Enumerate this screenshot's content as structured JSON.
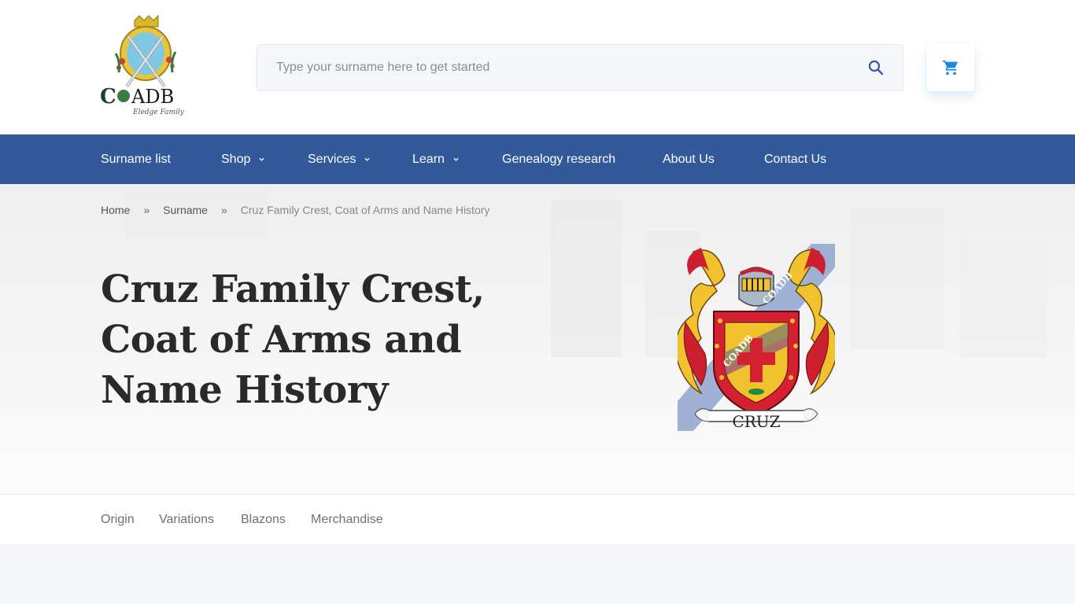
{
  "header": {
    "logo": {
      "text": "COADB",
      "subtitle": "Eledge Family"
    },
    "search": {
      "placeholder": "Type your surname here to get started",
      "value": ""
    },
    "icons": {
      "search": "search-icon",
      "cart": "shopping-cart-icon"
    }
  },
  "colors": {
    "nav_bg": "#325a9a",
    "accent": "#1e88e5",
    "search_icon": "#325a9a"
  },
  "nav": {
    "items": [
      {
        "label": "Surname list",
        "dropdown": false
      },
      {
        "label": "Shop",
        "dropdown": true
      },
      {
        "label": "Services",
        "dropdown": true
      },
      {
        "label": "Learn",
        "dropdown": true
      },
      {
        "label": "Genealogy research",
        "dropdown": false
      },
      {
        "label": "About Us",
        "dropdown": false
      },
      {
        "label": "Contact Us",
        "dropdown": false
      }
    ]
  },
  "breadcrumb": {
    "items": [
      "Home",
      "Surname",
      "Cruz Family Crest, Coat of Arms and Name History"
    ],
    "separator": "»"
  },
  "hero": {
    "title": "Cruz Family Crest, Coat of Arms and Name History",
    "crest": {
      "name": "CRUZ",
      "watermark": "COADB"
    }
  },
  "tabs": {
    "items": [
      "Origin",
      "Variations",
      "Blazons",
      "Merchandise"
    ]
  }
}
